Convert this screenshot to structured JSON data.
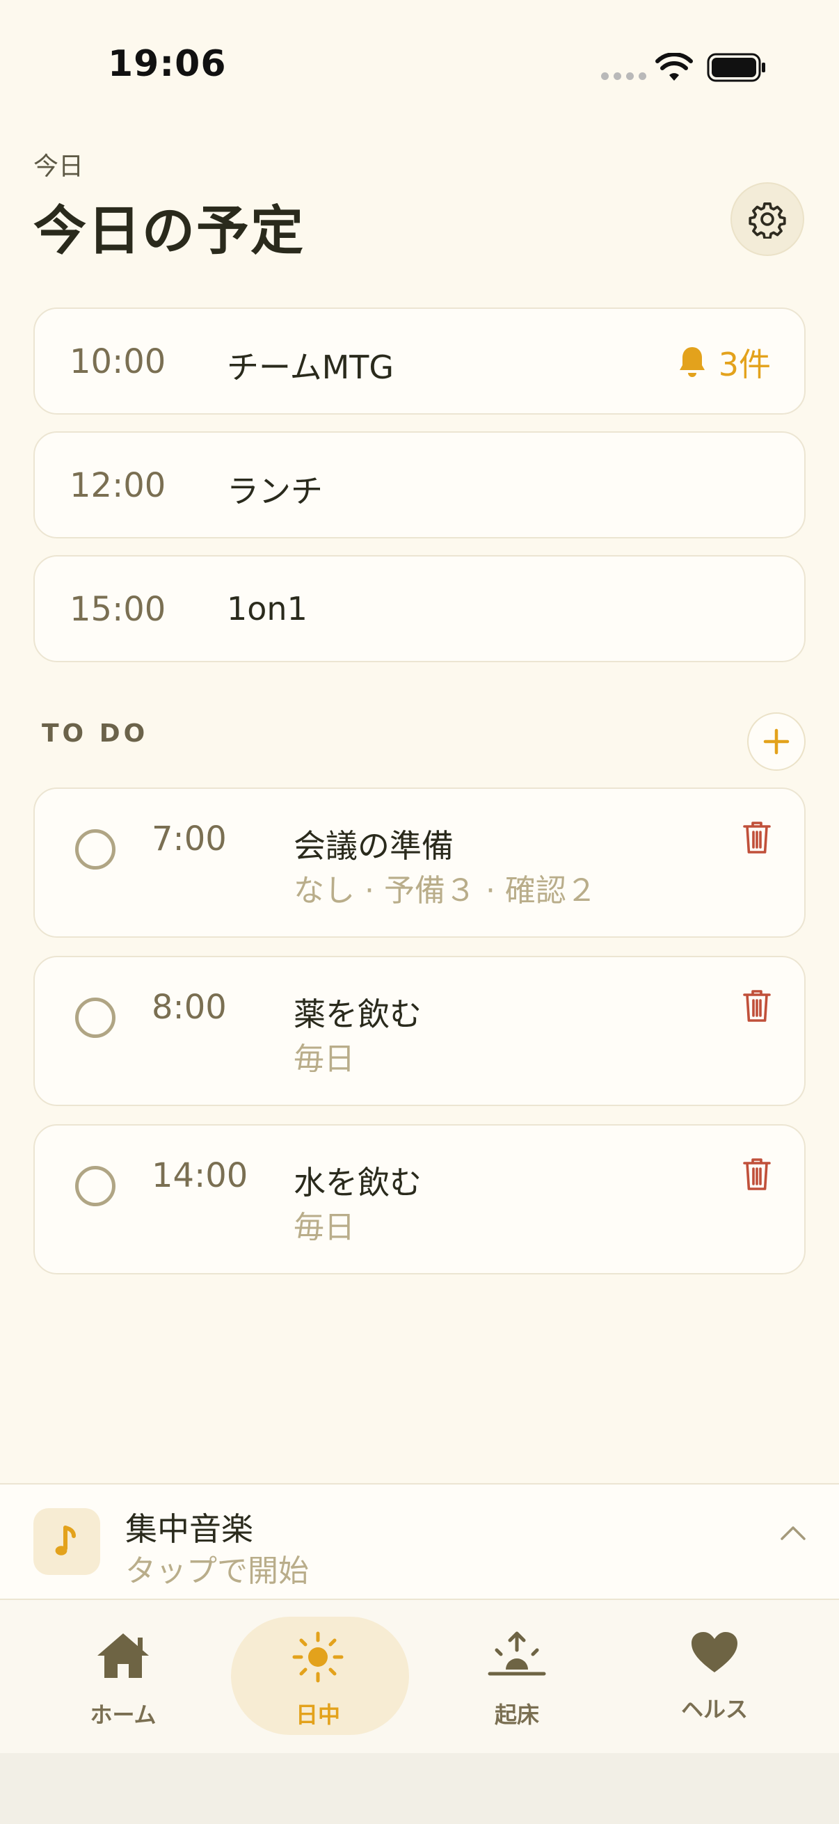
{
  "status_bar": {
    "time": "19:06"
  },
  "header": {
    "subtitle": "今日",
    "title": "今日の予定"
  },
  "schedule": [
    {
      "time": "10:00",
      "title": "チームMTG",
      "badge": "3件"
    },
    {
      "time": "12:00",
      "title": "ランチ"
    },
    {
      "time": "15:00",
      "title": "1on1"
    }
  ],
  "todo": {
    "heading": "TO DO",
    "items": [
      {
        "time": "7:00",
        "title": "会議の準備",
        "subtitle": "なし · 予備３ · 確認２"
      },
      {
        "time": "8:00",
        "title": "薬を飲む",
        "subtitle": "毎日"
      },
      {
        "time": "14:00",
        "title": "水を飲む",
        "subtitle": "毎日"
      }
    ]
  },
  "music": {
    "title": "集中音楽",
    "subtitle": "タップで開始"
  },
  "tabs": [
    {
      "label": "ホーム",
      "icon": "home-icon"
    },
    {
      "label": "日中",
      "icon": "sun-icon",
      "active": true
    },
    {
      "label": "起床",
      "icon": "sunrise-icon"
    },
    {
      "label": "ヘルス",
      "icon": "heart-icon"
    }
  ],
  "colors": {
    "accent": "#e3a21c",
    "danger": "#c0503a",
    "background": "#fdf9ee"
  }
}
